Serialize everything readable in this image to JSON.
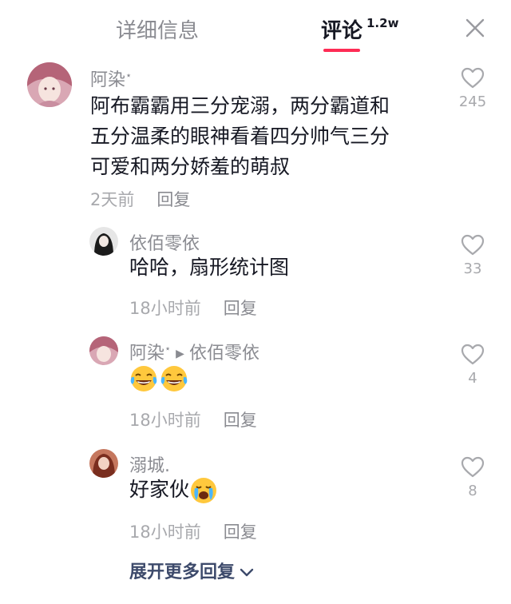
{
  "tabs": {
    "detail_label": "详细信息",
    "comments_label": "评论",
    "comments_count": "1.2w"
  },
  "icons": {
    "close": "close-icon",
    "like": "heart-outline-icon",
    "expand": "chevron-down-icon"
  },
  "colors": {
    "accent": "#fe2c55",
    "secondary_text": "#8a8b91",
    "expand_link": "#3d4a6b"
  },
  "comment": {
    "author": "阿染",
    "author_badge": "⋆",
    "lines": [
      "阿布霸霸用三分宠溺，两分霸道和",
      "五分温柔的眼神看着四分帅气三分",
      "可爱和两分娇羞的萌叔"
    ],
    "time": "2天前",
    "reply_label": "回复",
    "likes": "245"
  },
  "replies": [
    {
      "author": "依佰零依",
      "text": "哈哈，扇形统计图",
      "time": "18小时前",
      "reply_label": "回复",
      "likes": "33"
    },
    {
      "author": "阿染",
      "author_badge": "⋆",
      "reply_to": "依佰零依",
      "emoji": [
        "laughing-tears-emoji",
        "laughing-tears-emoji"
      ],
      "time": "18小时前",
      "reply_label": "回复",
      "likes": "4"
    },
    {
      "author": "溺城.",
      "text": "好家伙",
      "emoji": [
        "crying-face-emoji"
      ],
      "time": "18小时前",
      "reply_label": "回复",
      "likes": "8"
    }
  ],
  "expand_label": "展开更多回复"
}
